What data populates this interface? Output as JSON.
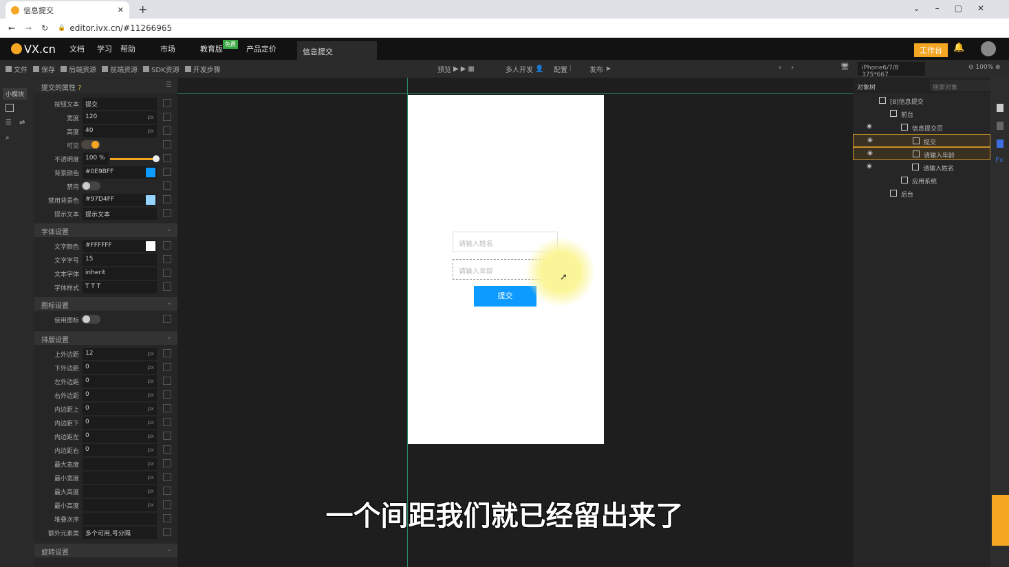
{
  "browser": {
    "tab_title": "信息提交",
    "url": "editor.ivx.cn/#11266965"
  },
  "header": {
    "logo": "VX.cn",
    "menu": [
      "文档",
      "学习",
      "帮助",
      "市场",
      "教育版",
      "产品定价"
    ],
    "free_badge": "免费",
    "project_tab": "信息提交",
    "workbench": "工作台"
  },
  "toolbar": {
    "left": [
      "文件",
      "保存",
      "后端资源",
      "前端资源",
      "SDK资源",
      "开发步骤"
    ],
    "preview": "预览",
    "multi": "多人开发",
    "config": "配置",
    "publish": "发布",
    "device": "iPhone6/7/8 375*667",
    "zoom": "100%"
  },
  "strip": {
    "label": "小模块"
  },
  "props": {
    "title": "提交的属性",
    "rows1": [
      {
        "label": "按钮文本",
        "value": "提交"
      },
      {
        "label": "宽度",
        "value": "120",
        "unit": "px"
      },
      {
        "label": "高度",
        "value": "40",
        "unit": "px"
      },
      {
        "label": "可见",
        "toggle": true
      },
      {
        "label": "不透明度",
        "value": "100 %",
        "slider": 1.0
      },
      {
        "label": "背景颜色",
        "value": "#0E9BFF",
        "swatch": "#0E9BFF"
      },
      {
        "label": "禁用",
        "toggle": false
      },
      {
        "label": "禁用背景色",
        "value": "#97D4FF",
        "swatch": "#97D4FF"
      },
      {
        "label": "提示文本",
        "value": "提示文本"
      }
    ],
    "font_section": "字体设置",
    "rows2": [
      {
        "label": "文字颜色",
        "value": "#FFFFFF",
        "swatch": "#FFFFFF"
      },
      {
        "label": "文字字号",
        "value": "15"
      },
      {
        "label": "文本字体",
        "value": "inherit"
      },
      {
        "label": "字体样式",
        "value": "T  T  T"
      }
    ],
    "icon_section": "图标设置",
    "rows3": [
      {
        "label": "使用图标",
        "toggle": false
      }
    ],
    "layout_section": "排版设置",
    "rows4": [
      {
        "label": "上外边距",
        "value": "12",
        "unit": "px"
      },
      {
        "label": "下外边距",
        "value": "0",
        "unit": "px"
      },
      {
        "label": "左外边距",
        "value": "0",
        "unit": "px"
      },
      {
        "label": "右外边距",
        "value": "0",
        "unit": "px"
      },
      {
        "label": "内边距上",
        "value": "0",
        "unit": "px"
      },
      {
        "label": "内边距下",
        "value": "0",
        "unit": "px"
      },
      {
        "label": "内边距左",
        "value": "0",
        "unit": "px"
      },
      {
        "label": "内边距右",
        "value": "0",
        "unit": "px"
      },
      {
        "label": "最大宽度",
        "value": "",
        "unit": "px"
      },
      {
        "label": "最小宽度",
        "value": "",
        "unit": "px"
      },
      {
        "label": "最大高度",
        "value": "",
        "unit": "px"
      },
      {
        "label": "最小高度",
        "value": "",
        "unit": "px"
      },
      {
        "label": "堆叠次序",
        "value": ""
      },
      {
        "label": "额外元素类",
        "value": "多个可用,号分隔"
      }
    ],
    "rotate_section": "旋转设置"
  },
  "phone": {
    "name_placeholder": "请输入姓名",
    "age_placeholder": "请输入年龄",
    "submit": "提交",
    "button_color": "#0E9BFF"
  },
  "tree": {
    "tab": "对象树",
    "search_placeholder": "搜索对象",
    "items": [
      {
        "label": "[8]信息提交",
        "indent": 0
      },
      {
        "label": "前台",
        "indent": 1
      },
      {
        "label": "信息提交页",
        "indent": 2,
        "eye": true
      },
      {
        "label": "提交",
        "indent": 3,
        "eye": true,
        "selected": true
      },
      {
        "label": "请输入年龄",
        "indent": 3,
        "eye": true,
        "selected": true
      },
      {
        "label": "请输入姓名",
        "indent": 3,
        "eye": true
      },
      {
        "label": "应用系统",
        "indent": 2
      },
      {
        "label": "后台",
        "indent": 1
      }
    ]
  },
  "subtitle": "一个间距我们就已经留出来了"
}
